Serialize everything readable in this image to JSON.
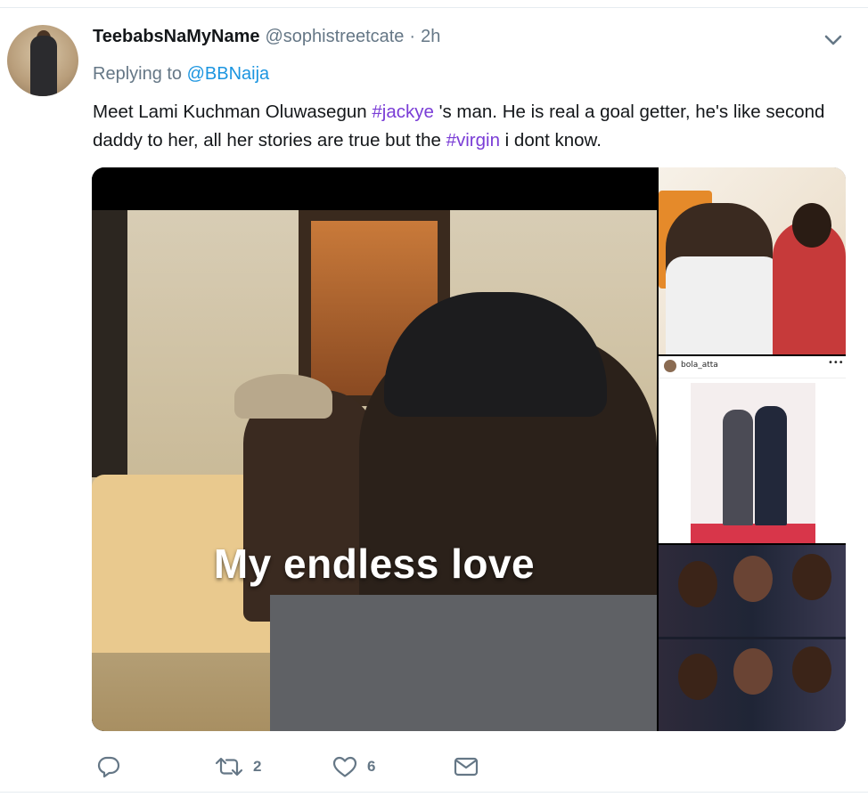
{
  "tweet": {
    "display_name": "TeebabsNaMyName",
    "handle": "@sophistreetcate",
    "separator": "·",
    "time": "2h",
    "replying_prefix": "Replying to",
    "replying_to": "@BBNaija",
    "text_parts": {
      "p1": "Meet Lami Kuchman Oluwasegun ",
      "hashtag1": "#jackye",
      "p2": "  's  man. He is real a goal getter, he's like second daddy to her, all her stories are true but the ",
      "hashtag2": "#virgin",
      "p3": " i dont know."
    }
  },
  "media": {
    "main_caption": "My endless love",
    "side_photo_user": "bola_atta",
    "side_photo_more": "•••"
  },
  "actions": {
    "reply_count": "",
    "retweet_count": "2",
    "like_count": "6"
  },
  "colors": {
    "link": "#1b95e0",
    "hashtag": "#7a3dd6",
    "muted": "#657786"
  },
  "icons": [
    "chevron-down-icon",
    "reply-icon",
    "retweet-icon",
    "like-icon",
    "direct-message-icon"
  ]
}
